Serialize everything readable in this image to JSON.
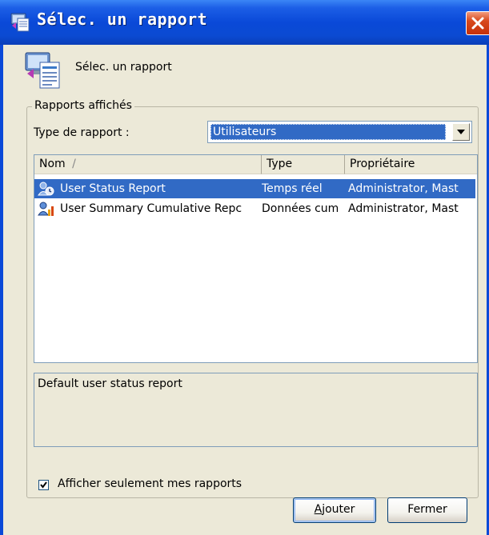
{
  "window": {
    "title": "Sélec. un rapport",
    "icon": "report-window-icon",
    "close_icon": "close-icon"
  },
  "header": {
    "text": "Sélec. un rapport",
    "icon": "report-select-icon"
  },
  "group": {
    "legend": "Rapports affichés",
    "type_label": "Type de rapport :",
    "type_selected": "Utilisateurs"
  },
  "list": {
    "columns": [
      {
        "label": "Nom",
        "sort_indicator": "/"
      },
      {
        "label": "Type"
      },
      {
        "label": "Propriétaire"
      }
    ],
    "rows": [
      {
        "name": "User Status Report",
        "type": "Temps réel",
        "owner": "Administrator, Mast",
        "icon": "user-status-report-icon",
        "selected": true
      },
      {
        "name": "User Summary Cumulative Repc",
        "type": "Données cum",
        "owner": "Administrator, Mast",
        "icon": "user-summary-report-icon",
        "selected": false
      }
    ]
  },
  "description": "Default user status report",
  "checkbox": {
    "label": "Afficher seulement mes rapports",
    "checked": true
  },
  "buttons": {
    "add_first": "A",
    "add_rest": "jouter",
    "close": "Fermer"
  },
  "colors": {
    "titlebar": "#0A49D8",
    "selection": "#316AC5",
    "dialog_bg": "#ECE9D8",
    "close_button": "#D8491D"
  }
}
